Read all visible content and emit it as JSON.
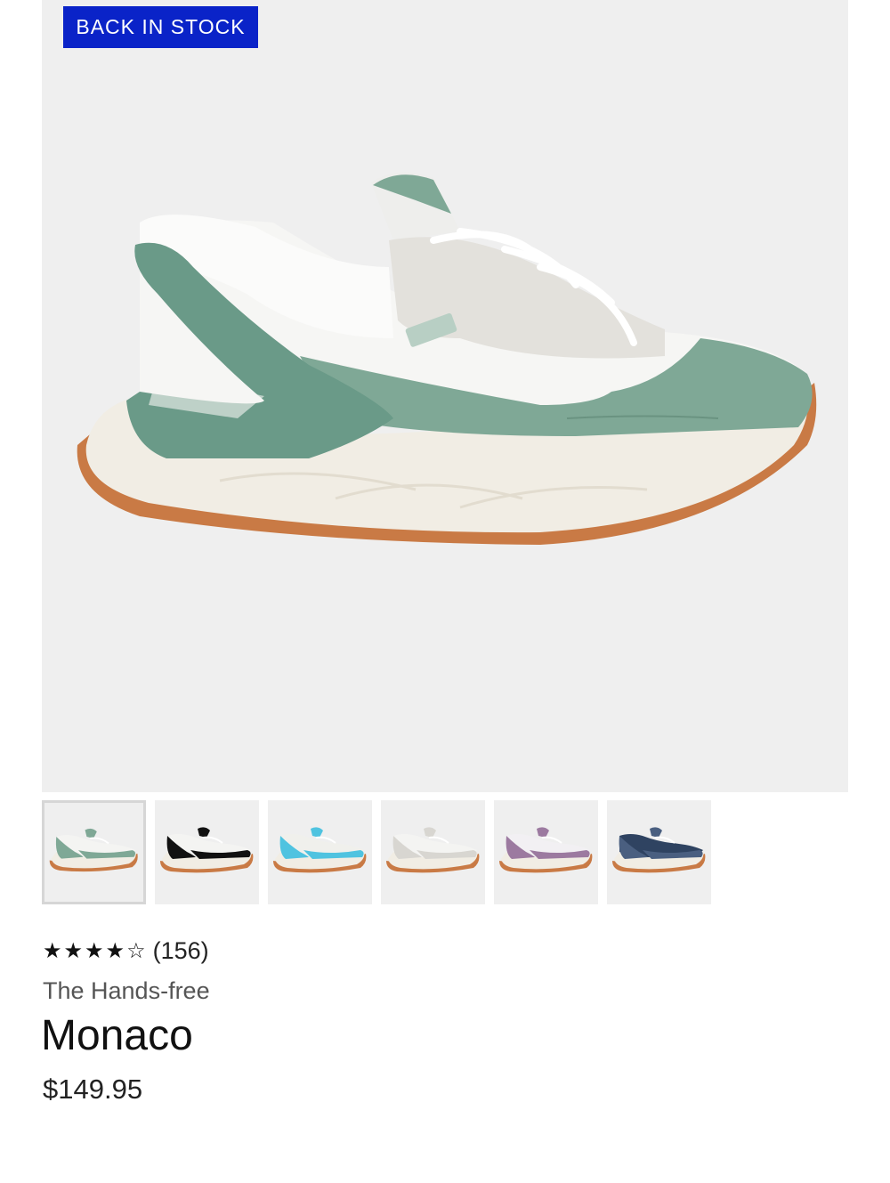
{
  "badge": {
    "label": "BACK IN STOCK"
  },
  "gallery": {
    "thumbnails": [
      {
        "color_name": "sage-green",
        "upper": "#f4f4f2",
        "accent": "#7fa896",
        "sole": "#f1ede4",
        "outsole": "#c97a45",
        "selected": true
      },
      {
        "color_name": "black",
        "upper": "#f4f4f2",
        "accent": "#111111",
        "sole": "#f1ede4",
        "outsole": "#c97a45",
        "selected": false
      },
      {
        "color_name": "aqua",
        "upper": "#f0f0ec",
        "accent": "#4fc3e0",
        "sole": "#f1ede4",
        "outsole": "#c97a45",
        "selected": false
      },
      {
        "color_name": "light-gray",
        "upper": "#f4f4f2",
        "accent": "#d8d6d1",
        "sole": "#f1ede4",
        "outsole": "#c97a45",
        "selected": false
      },
      {
        "color_name": "mauve",
        "upper": "#f2f0f3",
        "accent": "#9c7aa0",
        "sole": "#f1ede4",
        "outsole": "#c97a45",
        "selected": false
      },
      {
        "color_name": "navy",
        "upper": "#2f4361",
        "accent": "#4a5f80",
        "sole": "#f1ede4",
        "outsole": "#c97a45",
        "selected": false
      }
    ]
  },
  "product": {
    "rating_value": 4,
    "rating_max": 5,
    "review_count": "(156)",
    "subtitle": "The Hands-free",
    "name": "Monaco",
    "price": "$149.95"
  },
  "colors": {
    "badge_bg": "#0a23c8",
    "hero_bg": "#efefef",
    "sage": "#7fa896",
    "outsole": "#c97a45"
  }
}
